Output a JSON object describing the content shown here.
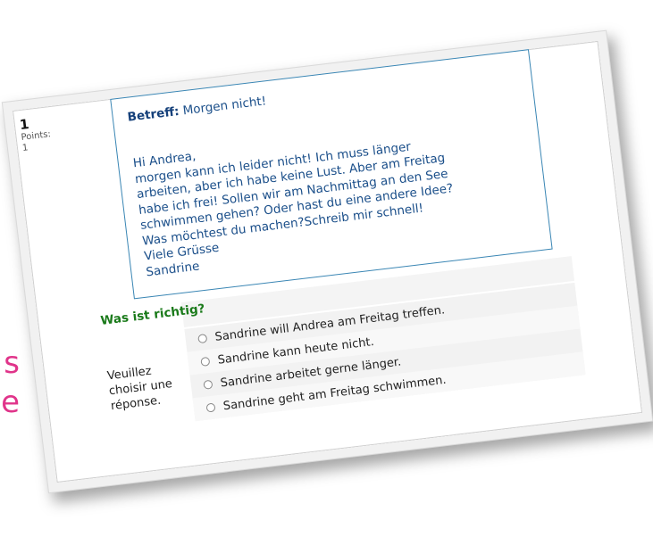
{
  "side_fragment": {
    "line1": "s",
    "line2": "e"
  },
  "question": {
    "number": "1",
    "points_label": "Points:",
    "points_value": "1"
  },
  "message": {
    "subject_label": "Betreff:",
    "subject_text": " Morgen nicht!",
    "body": "Hi Andrea,\nmorgen kann ich leider nicht! Ich muss länger\narbeiten, aber ich habe keine Lust. Aber am Freitag\nhabe ich frei!  Sollen wir am Nachmittag an den See\nschwimmen gehen? Oder hast du eine andere Idee?\nWas möchtest du machen?Schreib mir schnell!\nViele Grüsse\nSandrine"
  },
  "prompt": {
    "question_text": "Was ist richtig?",
    "instruction": "Veuillez choisir une réponse."
  },
  "options": [
    "Sandrine will Andrea am Freitag treffen.",
    "Sandrine kann heute nicht.",
    "Sandrine arbeitet gerne länger.",
    "Sandrine geht am Freitag schwimmen."
  ]
}
